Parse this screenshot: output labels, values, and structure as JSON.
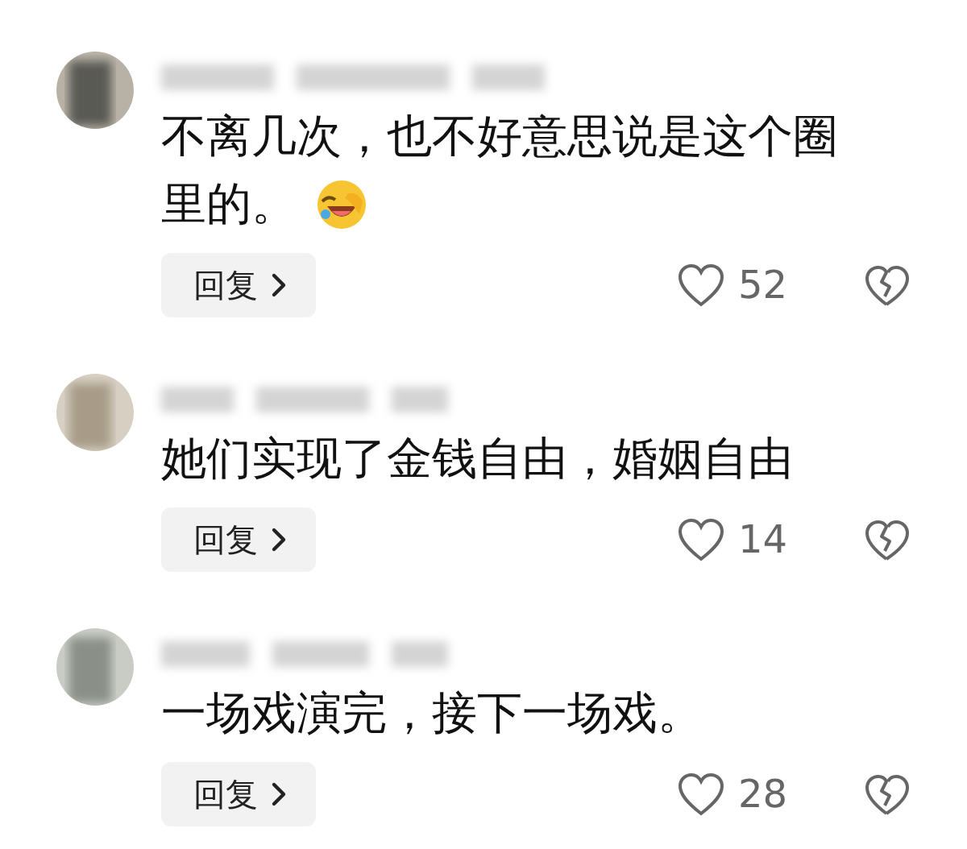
{
  "comments": [
    {
      "lines": [
        "不离几次，也不好意思说是这个圈",
        "里的。"
      ],
      "emoji": true,
      "reply": "回复",
      "likes": "52"
    },
    {
      "lines": [
        "她们实现了金钱自由，婚姻自由"
      ],
      "emoji": false,
      "reply": "回复",
      "likes": "14"
    },
    {
      "lines": [
        "一场戏演完，接下一场戏。"
      ],
      "emoji": false,
      "reply": "回复",
      "likes": "28"
    }
  ]
}
